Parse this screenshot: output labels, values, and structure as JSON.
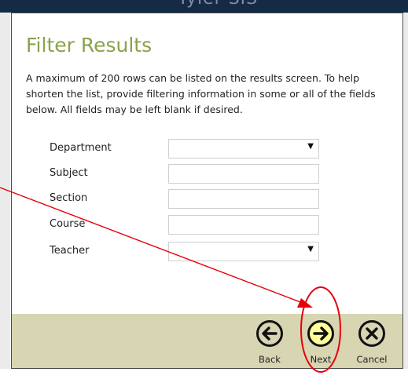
{
  "backdrop": {
    "logo_text": "Tyler SIS"
  },
  "dialog": {
    "title": "Filter Results",
    "instructions": "A maximum of 200 rows can be listed on the results screen. To help shorten the list, provide filtering information in some or all of the fields below. All fields may be left blank if desired."
  },
  "fields": {
    "department": {
      "label": "Department",
      "type": "select",
      "value": ""
    },
    "subject": {
      "label": "Subject",
      "type": "text",
      "value": ""
    },
    "section": {
      "label": "Section",
      "type": "text",
      "value": ""
    },
    "course": {
      "label": "Course",
      "type": "text",
      "value": ""
    },
    "teacher": {
      "label": "Teacher",
      "type": "select",
      "value": ""
    }
  },
  "buttons": {
    "back": {
      "label": "Back",
      "icon": "arrow-left-circle-icon"
    },
    "next": {
      "label": "Next",
      "icon": "arrow-right-circle-icon",
      "highlight_color": "#ffff99"
    },
    "cancel": {
      "label": "Cancel",
      "icon": "x-circle-icon"
    }
  },
  "annotation": {
    "color": "#e8000d",
    "arrow_target": "next-button"
  },
  "colors": {
    "title": "#8aa24a",
    "button_bar": "#d7d5b2",
    "backdrop": "#152b45"
  }
}
